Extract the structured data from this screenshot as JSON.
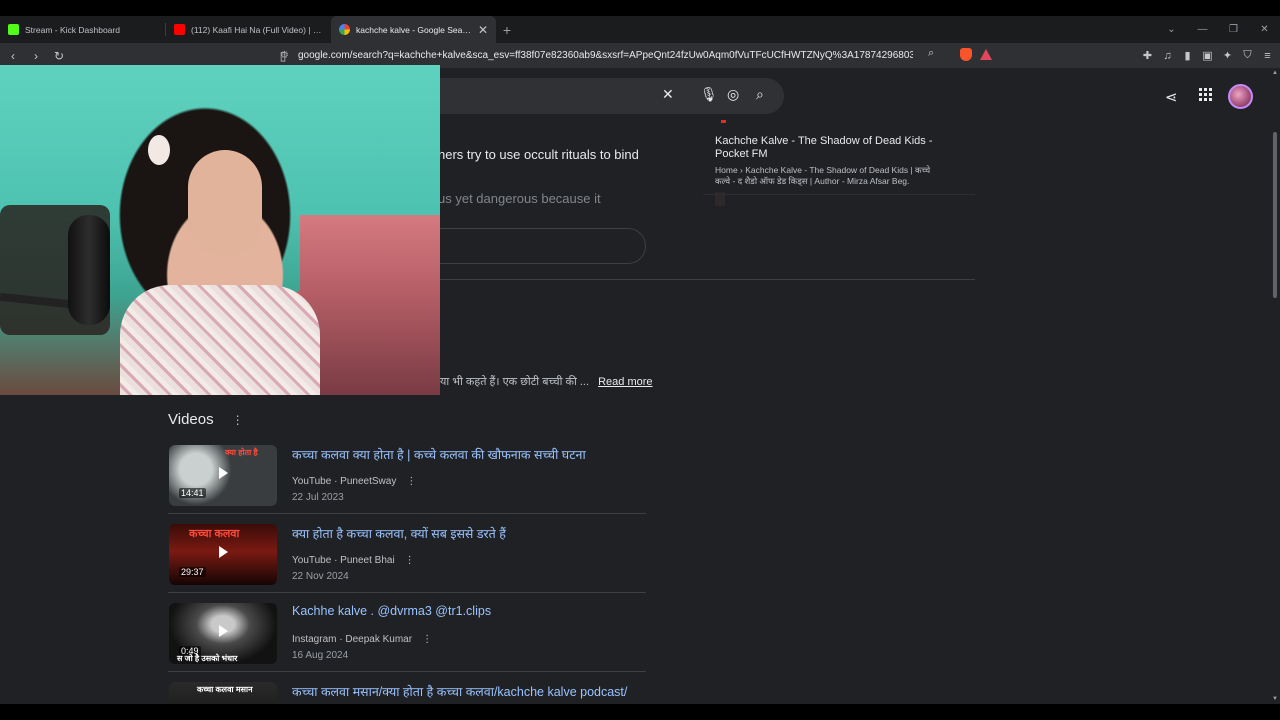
{
  "tabs": [
    {
      "title": "Stream - Kick Dashboard",
      "favicon_color": "#53fc18",
      "active": false
    },
    {
      "title": "(112) Kaafi Hai Na (Full Video) | Mus...",
      "favicon_color": "#ff0000",
      "active": false
    },
    {
      "title": "kachche kalve - Google Search",
      "favicon_color": "#4285f4",
      "active": true
    }
  ],
  "address_bar": {
    "url": "google.com/search?q=kachche+kalve&sca_esv=ff38f07e82360ab9&sxsrf=APpeQnt24fzUw0Aqm0fVuTFcUCfHWTZNyQ%3A1787429680341&sourc..."
  },
  "snippets": {
    "line1": "hers try to use occult rituals to bind",
    "line2": "us yet dangerous because it",
    "hindi_line": "या भी कहते हैं। एक छोटी बच्ची की ...",
    "read_more": "Read more"
  },
  "side_card": {
    "title": "Kachche Kalve - The Shadow of Dead Kids - Pocket FM",
    "description": "Home › Kachche Kalve - The Shadow of Dead Kids | कच्चे कल्वे - द शैडो ऑफ डेड किड्स | Author - Mirza Afsar Beg."
  },
  "videos": {
    "heading": "Videos",
    "items": [
      {
        "title": "कच्चा कलवा क्या होता है | कच्चे कलवा की खौफनाक सच्ची घटना",
        "source": "YouTube · PuneetSway",
        "date": "22 Jul 2023",
        "duration": "14:41",
        "thumb_caption": "क्या होता है"
      },
      {
        "title": "क्या होता है कच्चा कलवा, क्यों सब इससे डरते हैं",
        "source": "YouTube · Puneet Bhai",
        "date": "22 Nov 2024",
        "duration": "29:37",
        "thumb_caption": "कच्चा कलवा"
      },
      {
        "title": "Kachhe kalve . @dvrma3 @tr1.clips",
        "source": "Instagram · Deepak Kumar",
        "date": "16 Aug 2024",
        "duration": "0:49",
        "thumb_caption": "स जो है उसको भंधार"
      },
      {
        "title": "कच्चा कलवा मसान/क्या होता है कच्चा कलवा/kachche kalve podcast/",
        "source": "",
        "date": "",
        "duration": "",
        "thumb_caption": "कच्चा कलवा मसान"
      }
    ]
  },
  "colors": {
    "page_bg": "#202124",
    "link_blue": "#99c3ff",
    "accent_pink": "#c58af9"
  }
}
